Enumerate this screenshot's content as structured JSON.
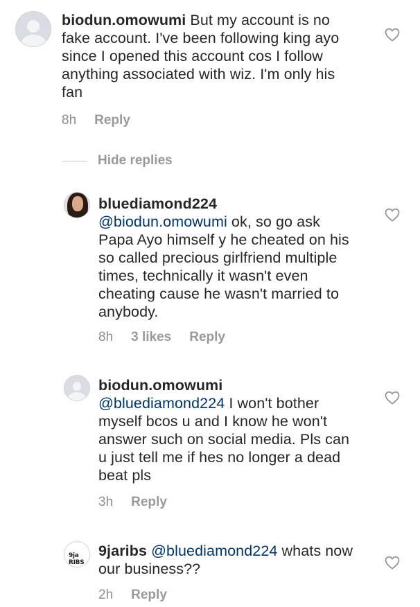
{
  "comments": [
    {
      "username": "biodun.omowumi",
      "text": " But my account is no fake account. I've been following king ayo since I opened this account cos I follow anything associated with wiz. I'm only his fan",
      "time": "8h",
      "reply": "Reply"
    }
  ],
  "replies_toggle": "Hide replies",
  "replies": [
    {
      "username": "bluediamond224",
      "mention": "@biodun.omowumi",
      "text": " ok, so go ask Papa Ayo himself y he cheated on his so called precious girlfriend multiple times, technically it wasn't even cheating cause he wasn't married to anybody.",
      "time": "8h",
      "likes": "3 likes",
      "reply": "Reply"
    },
    {
      "username": "biodun.omowumi",
      "mention": "@bluediamond224",
      "text": " I won't bother myself bcos u and I know he won't answer such on social media. Pls can u just tell me if hes no longer a dead beat pls",
      "time": "3h",
      "reply": "Reply"
    },
    {
      "username": "9jaribs",
      "avatar_text": "9ja RIBS",
      "mention": "@bluediamond224",
      "text": " whats now our business??",
      "time": "2h",
      "reply": "Reply"
    }
  ],
  "icons": {
    "like": "heart-icon",
    "avatar_default": "user-silhouette-icon"
  },
  "colors": {
    "text": "#262626",
    "muted": "#8e8e8e",
    "mention": "#003569"
  }
}
